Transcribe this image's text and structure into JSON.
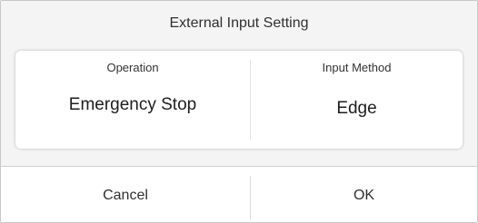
{
  "dialog": {
    "title": "External Input Setting"
  },
  "settings": {
    "operation": {
      "header": "Operation",
      "value": "Emergency Stop"
    },
    "input_method": {
      "header": "Input Method",
      "value": "Edge"
    }
  },
  "footer": {
    "cancel_label": "Cancel",
    "ok_label": "OK"
  }
}
